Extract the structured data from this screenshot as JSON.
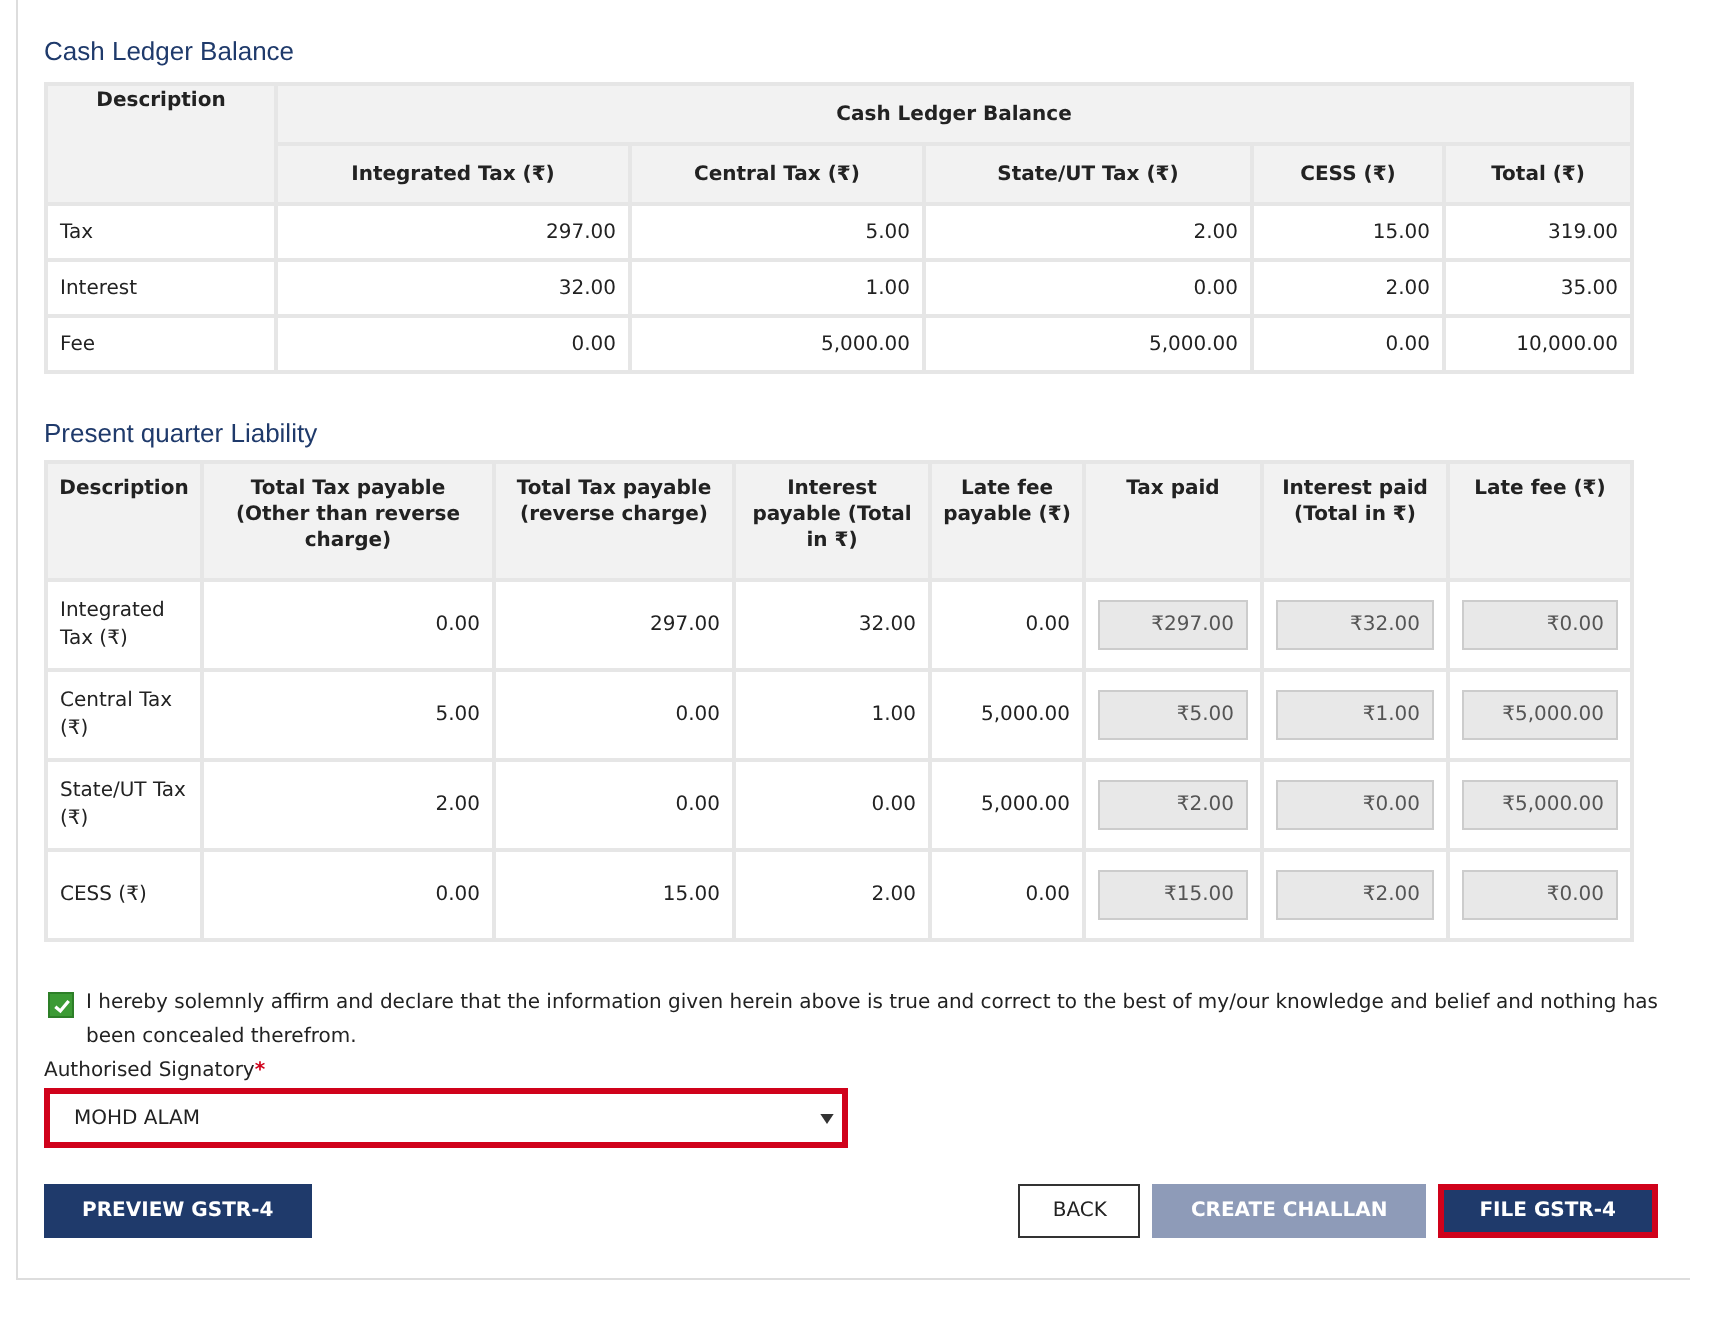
{
  "cash_ledger": {
    "title": "Cash Ledger Balance",
    "description_header": "Description",
    "group_header": "Cash Ledger Balance",
    "columns": [
      "Integrated Tax (₹)",
      "Central Tax (₹)",
      "State/UT Tax (₹)",
      "CESS (₹)",
      "Total (₹)"
    ],
    "rows": [
      {
        "label": "Tax",
        "values": [
          "297.00",
          "5.00",
          "2.00",
          "15.00",
          "319.00"
        ]
      },
      {
        "label": "Interest",
        "values": [
          "32.00",
          "1.00",
          "0.00",
          "2.00",
          "35.00"
        ]
      },
      {
        "label": "Fee",
        "values": [
          "0.00",
          "5,000.00",
          "5,000.00",
          "0.00",
          "10,000.00"
        ]
      }
    ]
  },
  "liability": {
    "title": "Present quarter Liability",
    "columns": [
      "Description",
      "Total Tax payable (Other than reverse charge)",
      "Total Tax payable (reverse charge)",
      "Interest payable (Total in ₹)",
      "Late fee payable (₹)",
      "Tax paid",
      "Interest paid (Total in ₹)",
      "Late fee (₹)"
    ],
    "rows": [
      {
        "label": "Integrated Tax (₹)",
        "values": [
          "0.00",
          "297.00",
          "32.00",
          "0.00"
        ],
        "paid": [
          "₹297.00",
          "₹32.00",
          "₹0.00"
        ]
      },
      {
        "label": "Central Tax (₹)",
        "values": [
          "5.00",
          "0.00",
          "1.00",
          "5,000.00"
        ],
        "paid": [
          "₹5.00",
          "₹1.00",
          "₹5,000.00"
        ]
      },
      {
        "label": "State/UT Tax (₹)",
        "values": [
          "2.00",
          "0.00",
          "0.00",
          "5,000.00"
        ],
        "paid": [
          "₹2.00",
          "₹0.00",
          "₹5,000.00"
        ]
      },
      {
        "label": "CESS (₹)",
        "values": [
          "0.00",
          "15.00",
          "2.00",
          "0.00"
        ],
        "paid": [
          "₹15.00",
          "₹2.00",
          "₹0.00"
        ]
      }
    ]
  },
  "declaration": {
    "checked": true,
    "text": "I hereby solemnly affirm and declare that the information given herein above is true and correct to the best of my/our knowledge and belief and nothing has been concealed therefrom."
  },
  "signatory": {
    "label": "Authorised Signatory",
    "required_mark": "*",
    "value": "MOHD ALAM",
    "highlighted": true
  },
  "left_buttons": [
    {
      "label": "PREVIEW GSTR-4",
      "kind": "primary",
      "highlighted": false
    }
  ],
  "right_buttons": [
    {
      "label": "BACK",
      "kind": "outline",
      "highlighted": false
    },
    {
      "label": "CREATE CHALLAN",
      "kind": "disabled",
      "highlighted": false
    },
    {
      "label": "FILE GSTR-4",
      "kind": "primary",
      "highlighted": true
    }
  ]
}
